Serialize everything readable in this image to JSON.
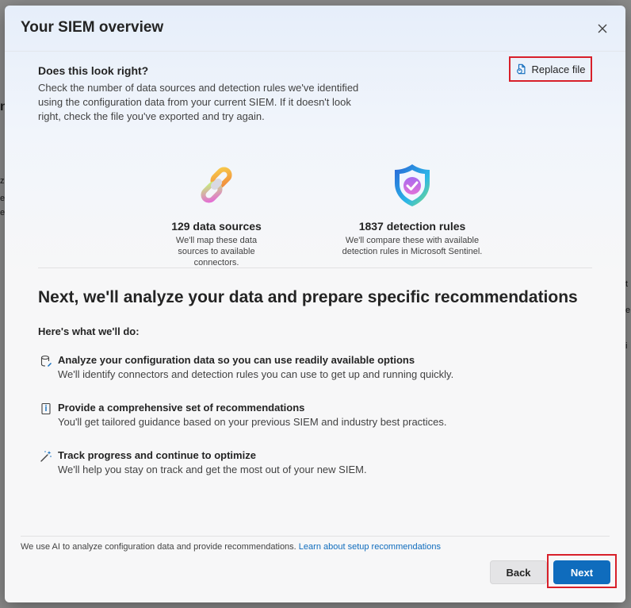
{
  "dialog": {
    "title": "Your SIEM overview",
    "close_icon": "close-icon"
  },
  "confirm": {
    "heading": "Does this look right?",
    "description": "Check the number of data sources and detection rules we've identified using the configuration data from your current SIEM. If it doesn't look right, check the file you've exported and try again.",
    "replace_label": "Replace file",
    "replace_icon": "document-sync-icon"
  },
  "stats": [
    {
      "icon": "chain-link-icon",
      "title": "129 data sources",
      "description": "We'll map these data sources to available connectors."
    },
    {
      "icon": "shield-check-icon",
      "title": "1837 detection rules",
      "description": "We'll compare these with available detection rules in Microsoft Sentinel."
    }
  ],
  "plan": {
    "heading": "Next, we'll analyze your data and prepare specific recommendations",
    "subheading": "Here's what we'll do:",
    "steps": [
      {
        "icon": "database-icon",
        "title": "Analyze your configuration data so you can use readily available options",
        "description": "We'll identify connectors and detection rules you can use to get up and running quickly."
      },
      {
        "icon": "book-icon",
        "title": "Provide a comprehensive set of recommendations",
        "description": "You'll get tailored guidance based on your previous SIEM and industry best practices."
      },
      {
        "icon": "magic-wand-icon",
        "title": "Track progress and continue to optimize",
        "description": "We'll help you stay on track and get the most out of your new SIEM."
      }
    ]
  },
  "footer": {
    "disclaimer": "We use AI to analyze configuration data and provide recommendations.",
    "link": "Learn about setup recommendations",
    "back_label": "Back",
    "next_label": "Next"
  },
  "colors": {
    "accent": "#0f6cbd",
    "highlight": "#d8202a"
  }
}
